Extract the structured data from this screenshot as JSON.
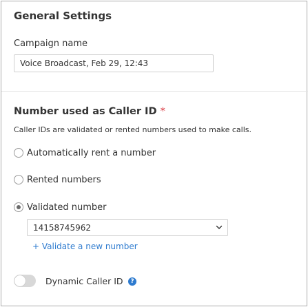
{
  "general_settings": {
    "title": "General Settings",
    "campaign_name_label": "Campaign name",
    "campaign_name_value": "Voice Broadcast, Feb 29, 12:43"
  },
  "caller_id": {
    "title": "Number used as Caller ID",
    "required_marker": "*",
    "help_text": "Caller IDs are validated or rented numbers used to make calls.",
    "options": [
      {
        "label": "Automatically rent a number",
        "selected": false
      },
      {
        "label": "Rented numbers",
        "selected": false
      },
      {
        "label": "Validated number",
        "selected": true
      }
    ],
    "validated_number_select": {
      "value": "14158745962"
    },
    "validate_link": "+ Validate a new number"
  },
  "dynamic_caller_id": {
    "label": "Dynamic Caller ID",
    "enabled": false,
    "help_icon": "question-circle-icon"
  },
  "colors": {
    "link": "#2e7bcf",
    "required": "#d9363e",
    "toggle_off": "#d8d8d8"
  }
}
